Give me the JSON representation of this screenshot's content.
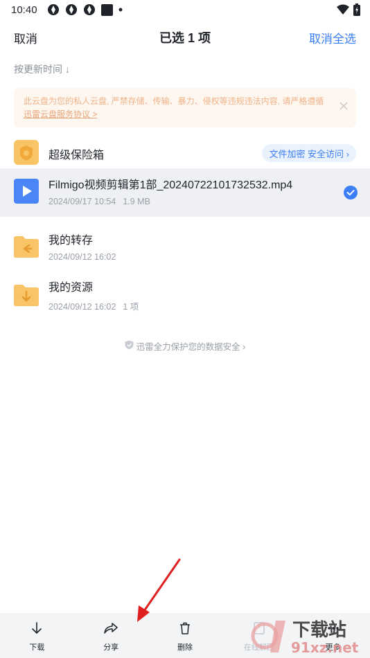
{
  "status": {
    "time": "10:40"
  },
  "header": {
    "cancel_label": "取消",
    "title": "已选 1 项",
    "deselect_all_label": "取消全选"
  },
  "sort_label": "按更新时间 ↓",
  "notice": {
    "text": "此云盘为您的私人云盘, 严禁存储、传输、暴力、侵权等违规违法内容, 请严格遵循",
    "link": "迅雷云盘服务协议 >"
  },
  "vault": {
    "name": "超级保险箱",
    "action_label": "文件加密 安全访问 ›"
  },
  "files": [
    {
      "name": "Filmigo视频剪辑第1部_20240722101732532.mp4",
      "date": "2024/09/17 10:54",
      "size": "1.9 MB",
      "selected": true,
      "type": "video"
    },
    {
      "name": "我的转存",
      "date": "2024/09/12 16:02",
      "size": "",
      "selected": false,
      "type": "folder-transfer"
    },
    {
      "name": "我的资源",
      "date": "2024/09/12 16:02",
      "size": "1 项",
      "selected": false,
      "type": "folder-resource"
    }
  ],
  "security_text": "迅雷全力保护您的数据安全 ›",
  "bottom_bar": [
    {
      "label": "下载",
      "icon": "download-icon",
      "disabled": false
    },
    {
      "label": "分享",
      "icon": "share-icon",
      "disabled": false
    },
    {
      "label": "删除",
      "icon": "delete-icon",
      "disabled": false
    },
    {
      "label": "在线解压",
      "icon": "unzip-icon",
      "disabled": true
    },
    {
      "label": "更多",
      "icon": "more-icon",
      "disabled": false
    }
  ],
  "watermark": {
    "text_top": "下载站",
    "text_bottom": "91xz.net"
  },
  "colors": {
    "accent": "#3b7ef7",
    "folder": "#f9c466",
    "video": "#4a86f6",
    "arrow": "#e02020"
  }
}
